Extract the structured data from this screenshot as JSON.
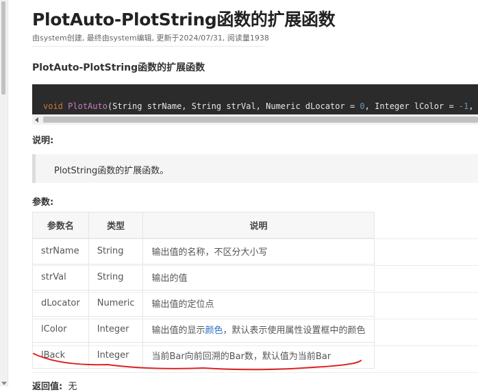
{
  "page": {
    "title": "PlotAuto-PlotString函数的扩展函数",
    "meta": "由system创建, 最终由system编辑, 更新于2024/07/31, 阅读量1938",
    "section_title": "PlotAuto-PlotString函数的扩展函数"
  },
  "code": {
    "kw_void": "void",
    "fn_name": "PlotAuto",
    "sig_part1": "(String strName, String strVal, Numeric dLocator = ",
    "num_zero": "0",
    "sig_part2": ", Integer lColor = ",
    "num_neg_one": "-1",
    "sig_part3": ", Int"
  },
  "description": {
    "label": "说明:",
    "text": "PlotString函数的扩展函数。"
  },
  "params": {
    "label": "参数:",
    "headers": [
      "参数名",
      "类型",
      "说明"
    ],
    "rows": [
      {
        "name": "strName",
        "type": "String",
        "desc": "输出值的名称，不区分大小写"
      },
      {
        "name": "strVal",
        "type": "String",
        "desc": "输出的值"
      },
      {
        "name": "dLocator",
        "type": "Numeric",
        "desc": "输出值的定位点"
      },
      {
        "name": "lColor",
        "type": "Integer",
        "desc_pre": "输出值的显示",
        "desc_link": "颜色",
        "desc_post": "，默认表示使用属性设置框中的颜色"
      },
      {
        "name": "lBack",
        "type": "Integer",
        "desc": "当前Bar向前回溯的Bar数，默认值为当前Bar"
      }
    ]
  },
  "returns": {
    "label": "返回值:",
    "value": "无"
  },
  "colors": {
    "code_bg": "#2b2b2b",
    "keyword": "#cc7832",
    "function": "#c77dbb",
    "number": "#6897bb",
    "link": "#2a6cc8",
    "annotation": "#e02020"
  }
}
